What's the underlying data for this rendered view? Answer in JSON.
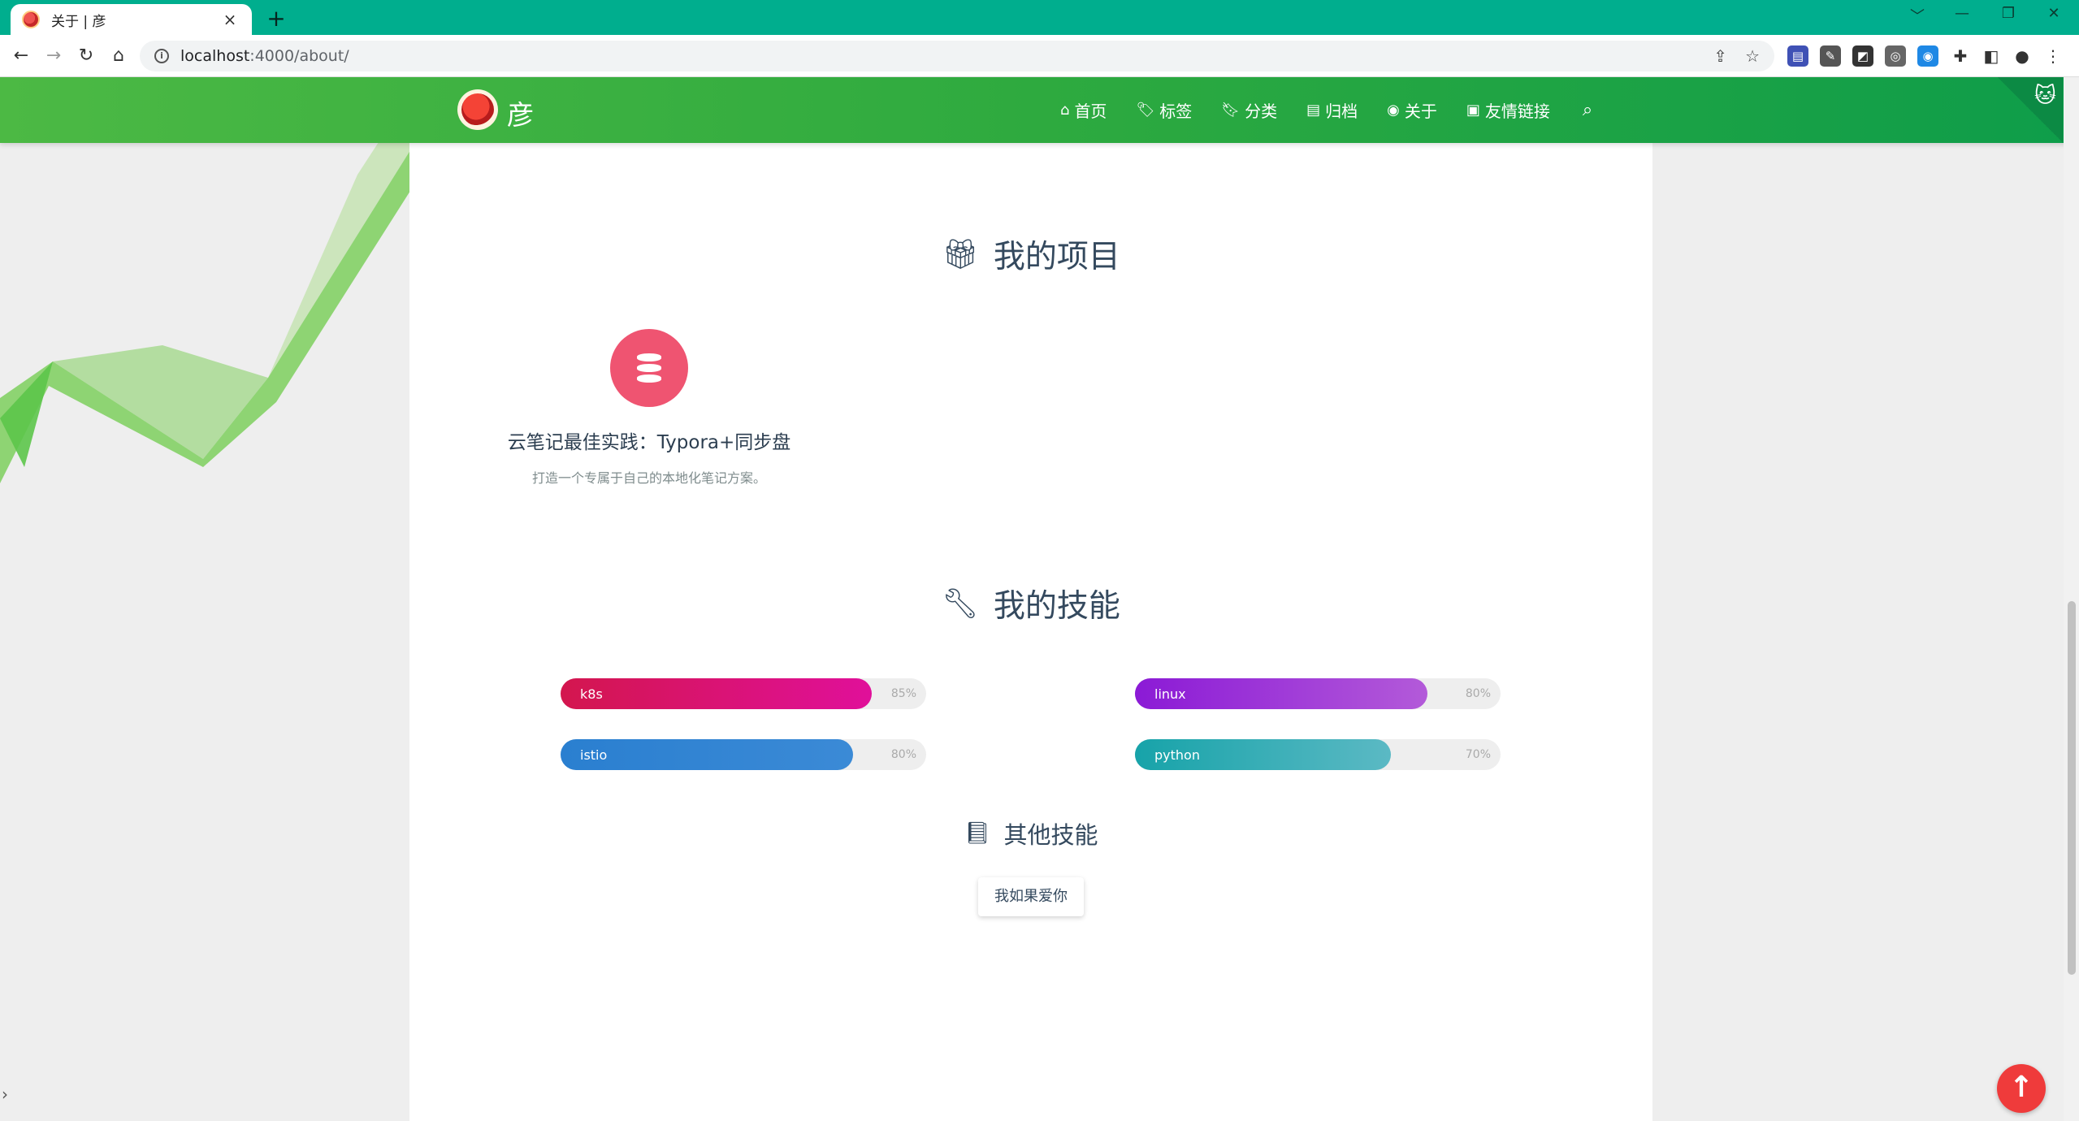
{
  "browser": {
    "tab_title": "关于 | 彦",
    "tab_close": "×",
    "new_tab": "+",
    "url_host": "localhost",
    "url_path": ":4000/about/",
    "window_controls": [
      "﹀",
      "—",
      "❐",
      "✕"
    ]
  },
  "site": {
    "brand": "彦",
    "menu": [
      {
        "icon": "home-icon",
        "label": "首页"
      },
      {
        "icon": "tags-icon",
        "label": "标签"
      },
      {
        "icon": "bookmark-icon",
        "label": "分类"
      },
      {
        "icon": "archive-icon",
        "label": "归档"
      },
      {
        "icon": "user-circle-icon",
        "label": "关于"
      },
      {
        "icon": "address-book-icon",
        "label": "友情链接"
      }
    ]
  },
  "projects_section": {
    "title": "我的项目",
    "icon": "gift-icon",
    "items": [
      {
        "title": "云笔记最佳实践：Typora+同步盘",
        "desc": "打造一个专属于自己的本地化笔记方案。",
        "icon": "database-icon",
        "color": "#ef5471"
      }
    ]
  },
  "skills_section": {
    "title": "我的技能",
    "icon": "wrench-icon",
    "skills": [
      {
        "name": "k8s",
        "percent": 85,
        "percent_label": "85%",
        "gradient": [
          "#d3164e",
          "#e0109a"
        ]
      },
      {
        "name": "linux",
        "percent": 80,
        "percent_label": "80%",
        "gradient": [
          "#8b1ad6",
          "#b35ad9"
        ]
      },
      {
        "name": "istio",
        "percent": 80,
        "percent_label": "80%",
        "gradient": [
          "#2a7fd0",
          "#3b8ad6"
        ]
      },
      {
        "name": "python",
        "percent": 70,
        "percent_label": "70%",
        "gradient": [
          "#17a3a9",
          "#5bb9c4"
        ]
      }
    ],
    "other_title": "其他技能",
    "other_icon": "book-icon",
    "other_tags": [
      "我如果爱你"
    ]
  },
  "back_to_top": "↑"
}
